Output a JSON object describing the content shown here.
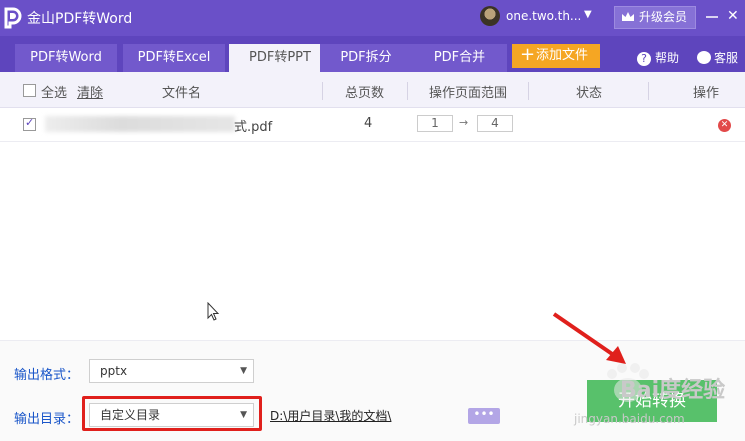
{
  "app": {
    "title": "金山PDF转Word",
    "username": "one.two.th...",
    "upgrade_label": "升级会员"
  },
  "tabs": [
    "PDF转Word",
    "PDF转Excel",
    "PDF转PPT",
    "PDF拆分",
    "PDF合并"
  ],
  "active_tab": "PDF转PPT",
  "toolbar": {
    "add_file": "添加文件",
    "help": "帮助",
    "service": "客服"
  },
  "table": {
    "select_all": "全选",
    "clear": "清除",
    "headers": {
      "filename": "文件名",
      "pages": "总页数",
      "range": "操作页面范围",
      "status": "状态",
      "action": "操作"
    },
    "rows": [
      {
        "checked": true,
        "filename": "式.pdf",
        "pages": "4",
        "range_from": "1",
        "range_to": "4",
        "status": ""
      }
    ]
  },
  "output": {
    "format_label": "输出格式：",
    "format_value": "pptx",
    "dir_label": "输出目录：",
    "dir_value": "自定义目录",
    "dir_path": "D:\\用户目录\\我的文档\\",
    "browse_label": "•••",
    "start_label": "开始转换"
  },
  "watermark": {
    "brand": "Bai度经验",
    "url": "jingyan.baidu.com"
  },
  "colors": {
    "header_purple": "#6a50c8",
    "accent_orange": "#f5a623",
    "start_green": "#58c16b",
    "highlight_red": "#e0201c"
  }
}
